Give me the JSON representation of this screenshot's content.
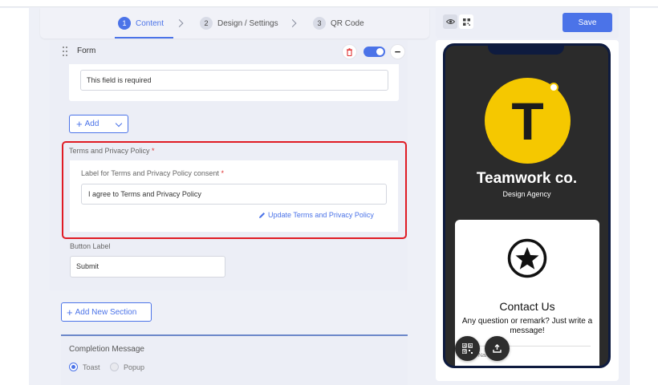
{
  "stepper": {
    "steps": [
      {
        "num": "1",
        "label": "Content"
      },
      {
        "num": "2",
        "label": "Design / Settings"
      },
      {
        "num": "3",
        "label": "QR Code"
      }
    ]
  },
  "form": {
    "title": "Form",
    "required_message_value": "This field is required",
    "add_label": "Add",
    "terms": {
      "title": "Terms and Privacy Policy",
      "required_mark": "*",
      "consent_label": "Label for Terms and Privacy Policy consent",
      "consent_value": "I agree to Terms and Privacy Policy",
      "update_link": "Update Terms and Privacy Policy"
    },
    "button_label_title": "Button Label",
    "button_label_value": "Submit"
  },
  "add_section_label": "Add New Section",
  "completion": {
    "title": "Completion Message",
    "options": [
      "Toast",
      "Popup"
    ],
    "selected": "Toast"
  },
  "preview": {
    "save_label": "Save",
    "logo_letter": "T",
    "company_name": "Teamwork co.",
    "tagline": "Design Agency",
    "contact_title": "Contact Us",
    "contact_subtitle": "Any question or remark? Just write a message!",
    "name_field_label": "Name"
  },
  "colors": {
    "accent": "#4b73e8",
    "highlight": "#e01b24",
    "logo_yellow": "#f5c800",
    "phone_bg": "#2b2b2b"
  }
}
